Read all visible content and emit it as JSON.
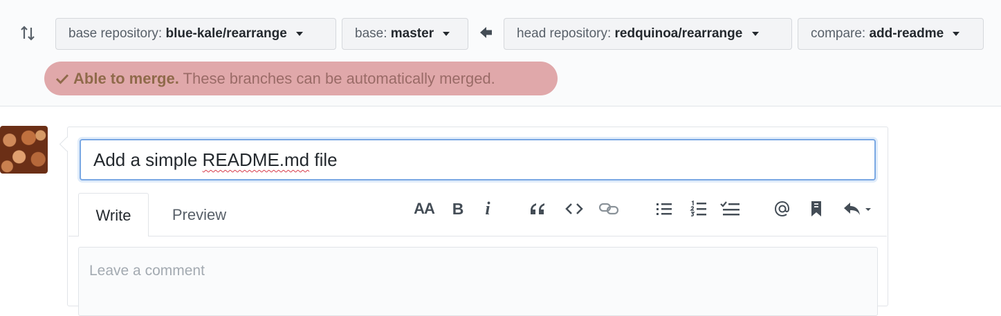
{
  "range_editor": {
    "base_repository": {
      "prefix": "base repository:",
      "value": "blue-kale/rearrange"
    },
    "base_branch": {
      "prefix": "base:",
      "value": "master"
    },
    "head_repository": {
      "prefix": "head repository:",
      "value": "redquinoa/rearrange"
    },
    "compare_branch": {
      "prefix": "compare:",
      "value": "add-readme"
    }
  },
  "merge_status": {
    "strong": "Able to merge.",
    "text": "These branches can be automatically merged."
  },
  "pr_form": {
    "title_value_pre": "Add a simple",
    "title_value_misspelled": "README.md",
    "title_value_post": "file",
    "tabs": {
      "write": "Write",
      "preview": "Preview"
    },
    "toolbar": {
      "heading": "AA",
      "bold": "B",
      "italic": "i"
    },
    "comment_placeholder": "Leave a comment"
  },
  "colors": {
    "merge_badge_bg": "#e0a8aa",
    "input_focus_border": "#79a7e3"
  },
  "icons": [
    "git-compare-icon",
    "arrow-left-icon",
    "check-icon",
    "heading-icon",
    "bold-icon",
    "italic-icon",
    "quote-icon",
    "code-icon",
    "link-icon",
    "unordered-list-icon",
    "ordered-list-icon",
    "task-list-icon",
    "mention-icon",
    "bookmark-icon",
    "reply-icon"
  ]
}
